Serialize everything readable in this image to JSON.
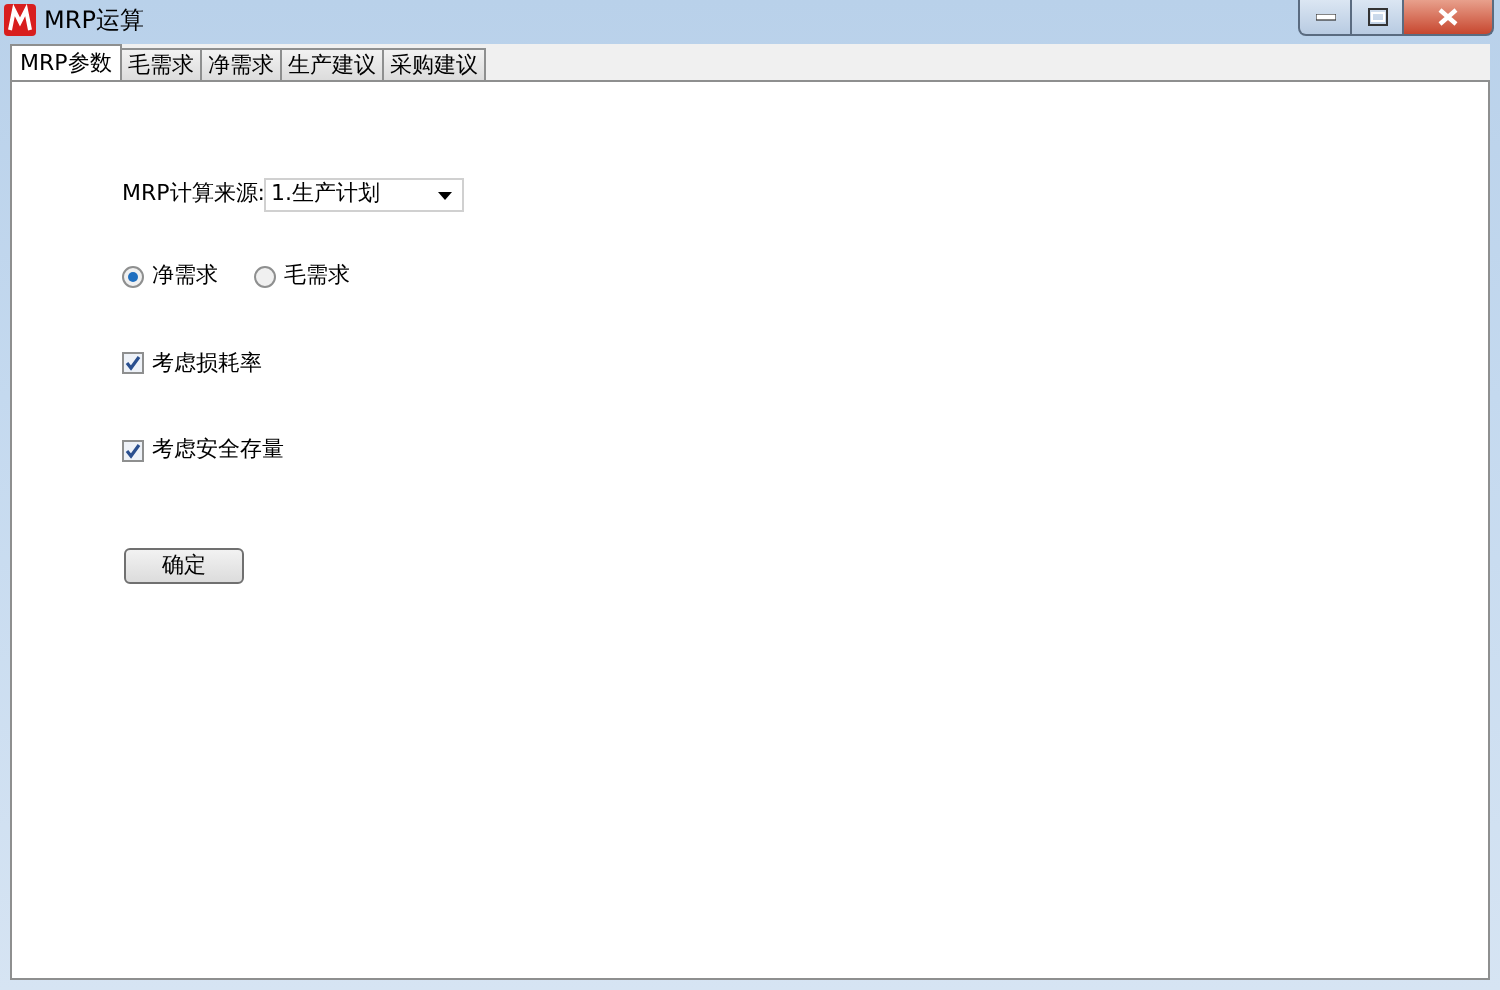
{
  "window": {
    "title": "MRP运算"
  },
  "tabs": [
    {
      "label": "MRP参数",
      "selected": true
    },
    {
      "label": "毛需求",
      "selected": false
    },
    {
      "label": "净需求",
      "selected": false
    },
    {
      "label": "生产建议",
      "selected": false
    },
    {
      "label": "采购建议",
      "selected": false
    }
  ],
  "source": {
    "label": "MRP计算来源:",
    "value": "1.生产计划"
  },
  "demand_type": [
    {
      "label": "净需求",
      "selected": true
    },
    {
      "label": "毛需求",
      "selected": false
    }
  ],
  "options": [
    {
      "label": "考虑损耗率",
      "checked": true
    },
    {
      "label": "考虑安全存量",
      "checked": true
    }
  ],
  "confirm_button": "确定"
}
